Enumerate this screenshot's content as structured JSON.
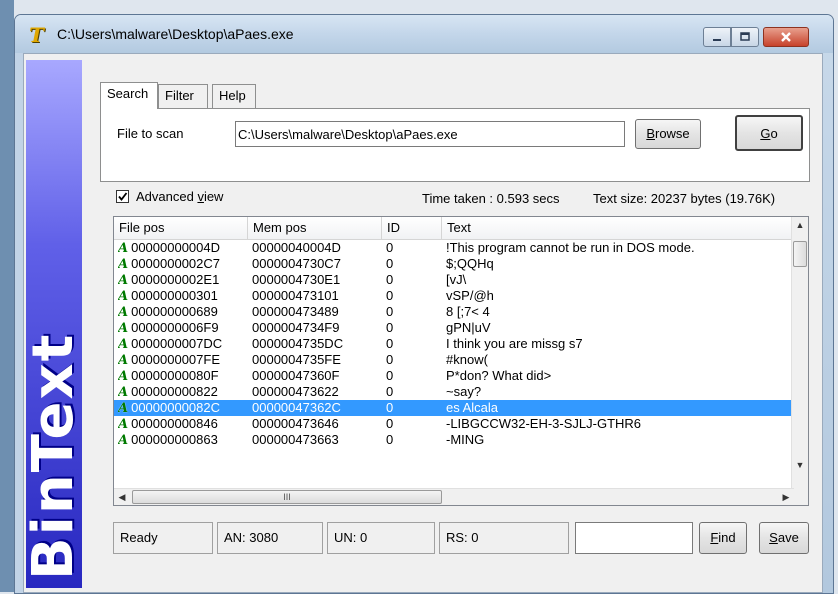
{
  "window": {
    "title": "C:\\Users\\malware\\Desktop\\aPaes.exe"
  },
  "banner": {
    "text": "BinText",
    "color": "#2828c0"
  },
  "tabs": [
    {
      "label": "Search",
      "active": true
    },
    {
      "label": "Filter",
      "active": false
    },
    {
      "label": "Help",
      "active": false
    }
  ],
  "scan": {
    "file_label": "File to scan",
    "file_value": "C:\\Users\\malware\\Desktop\\aPaes.exe",
    "browse_label": "Browse",
    "browse_mnemonic": "B",
    "browse_rest": "rowse",
    "go_label": "Go",
    "go_mnemonic": "G",
    "go_rest": "o"
  },
  "options": {
    "advanced_view_checked": true,
    "advanced_view_pre": "Advanced ",
    "advanced_view_mnemonic": "v",
    "advanced_view_rest": "iew",
    "time_taken": "Time taken : 0.593 secs",
    "text_size": "Text size: 20237 bytes (19.76K)"
  },
  "table": {
    "columns": [
      "File pos",
      "Mem pos",
      "ID",
      "Text"
    ],
    "rows": [
      {
        "type": "A",
        "file_pos": "00000000004D",
        "mem_pos": "00000040004D",
        "id": "0",
        "text": "!This program cannot be run in DOS mode.",
        "selected": false
      },
      {
        "type": "A",
        "file_pos": "0000000002C7",
        "mem_pos": "0000004730C7",
        "id": "0",
        "text": "$;QQHq",
        "selected": false
      },
      {
        "type": "A",
        "file_pos": "0000000002E1",
        "mem_pos": "0000004730E1",
        "id": "0",
        "text": "[vJ\\",
        "selected": false
      },
      {
        "type": "A",
        "file_pos": "000000000301",
        "mem_pos": "000000473101",
        "id": "0",
        "text": "vSP/@h",
        "selected": false
      },
      {
        "type": "A",
        "file_pos": "000000000689",
        "mem_pos": "000000473489",
        "id": "0",
        "text": "8 [;7< 4",
        "selected": false
      },
      {
        "type": "A",
        "file_pos": "0000000006F9",
        "mem_pos": "0000004734F9",
        "id": "0",
        "text": "gPN|uV",
        "selected": false
      },
      {
        "type": "A",
        "file_pos": "0000000007DC",
        "mem_pos": "0000004735DC",
        "id": "0",
        "text": "I think you are missg s7",
        "selected": false
      },
      {
        "type": "A",
        "file_pos": "0000000007FE",
        "mem_pos": "0000004735FE",
        "id": "0",
        "text": "#know(",
        "selected": false
      },
      {
        "type": "A",
        "file_pos": "00000000080F",
        "mem_pos": "00000047360F",
        "id": "0",
        "text": "P*don? What did>",
        "selected": false
      },
      {
        "type": "A",
        "file_pos": "000000000822",
        "mem_pos": "000000473622",
        "id": "0",
        "text": "~say?",
        "selected": false
      },
      {
        "type": "A",
        "file_pos": "00000000082C",
        "mem_pos": "00000047362C",
        "id": "0",
        "text": "es Alcala",
        "selected": true
      },
      {
        "type": "A",
        "file_pos": "000000000846",
        "mem_pos": "000000473646",
        "id": "0",
        "text": "-LIBGCCW32-EH-3-SJLJ-GTHR6",
        "selected": false
      },
      {
        "type": "A",
        "file_pos": "000000000863",
        "mem_pos": "000000473663",
        "id": "0",
        "text": "-MING",
        "selected": false
      }
    ],
    "selected_color": "#3399ff",
    "hscroll_grip": "III"
  },
  "status": {
    "ready": "Ready",
    "an": "AN: 3080",
    "un": "UN: 0",
    "rs": "RS: 0",
    "find_value": "",
    "find_mnemonic": "F",
    "find_rest": "ind",
    "save_mnemonic": "S",
    "save_rest": "ave"
  }
}
